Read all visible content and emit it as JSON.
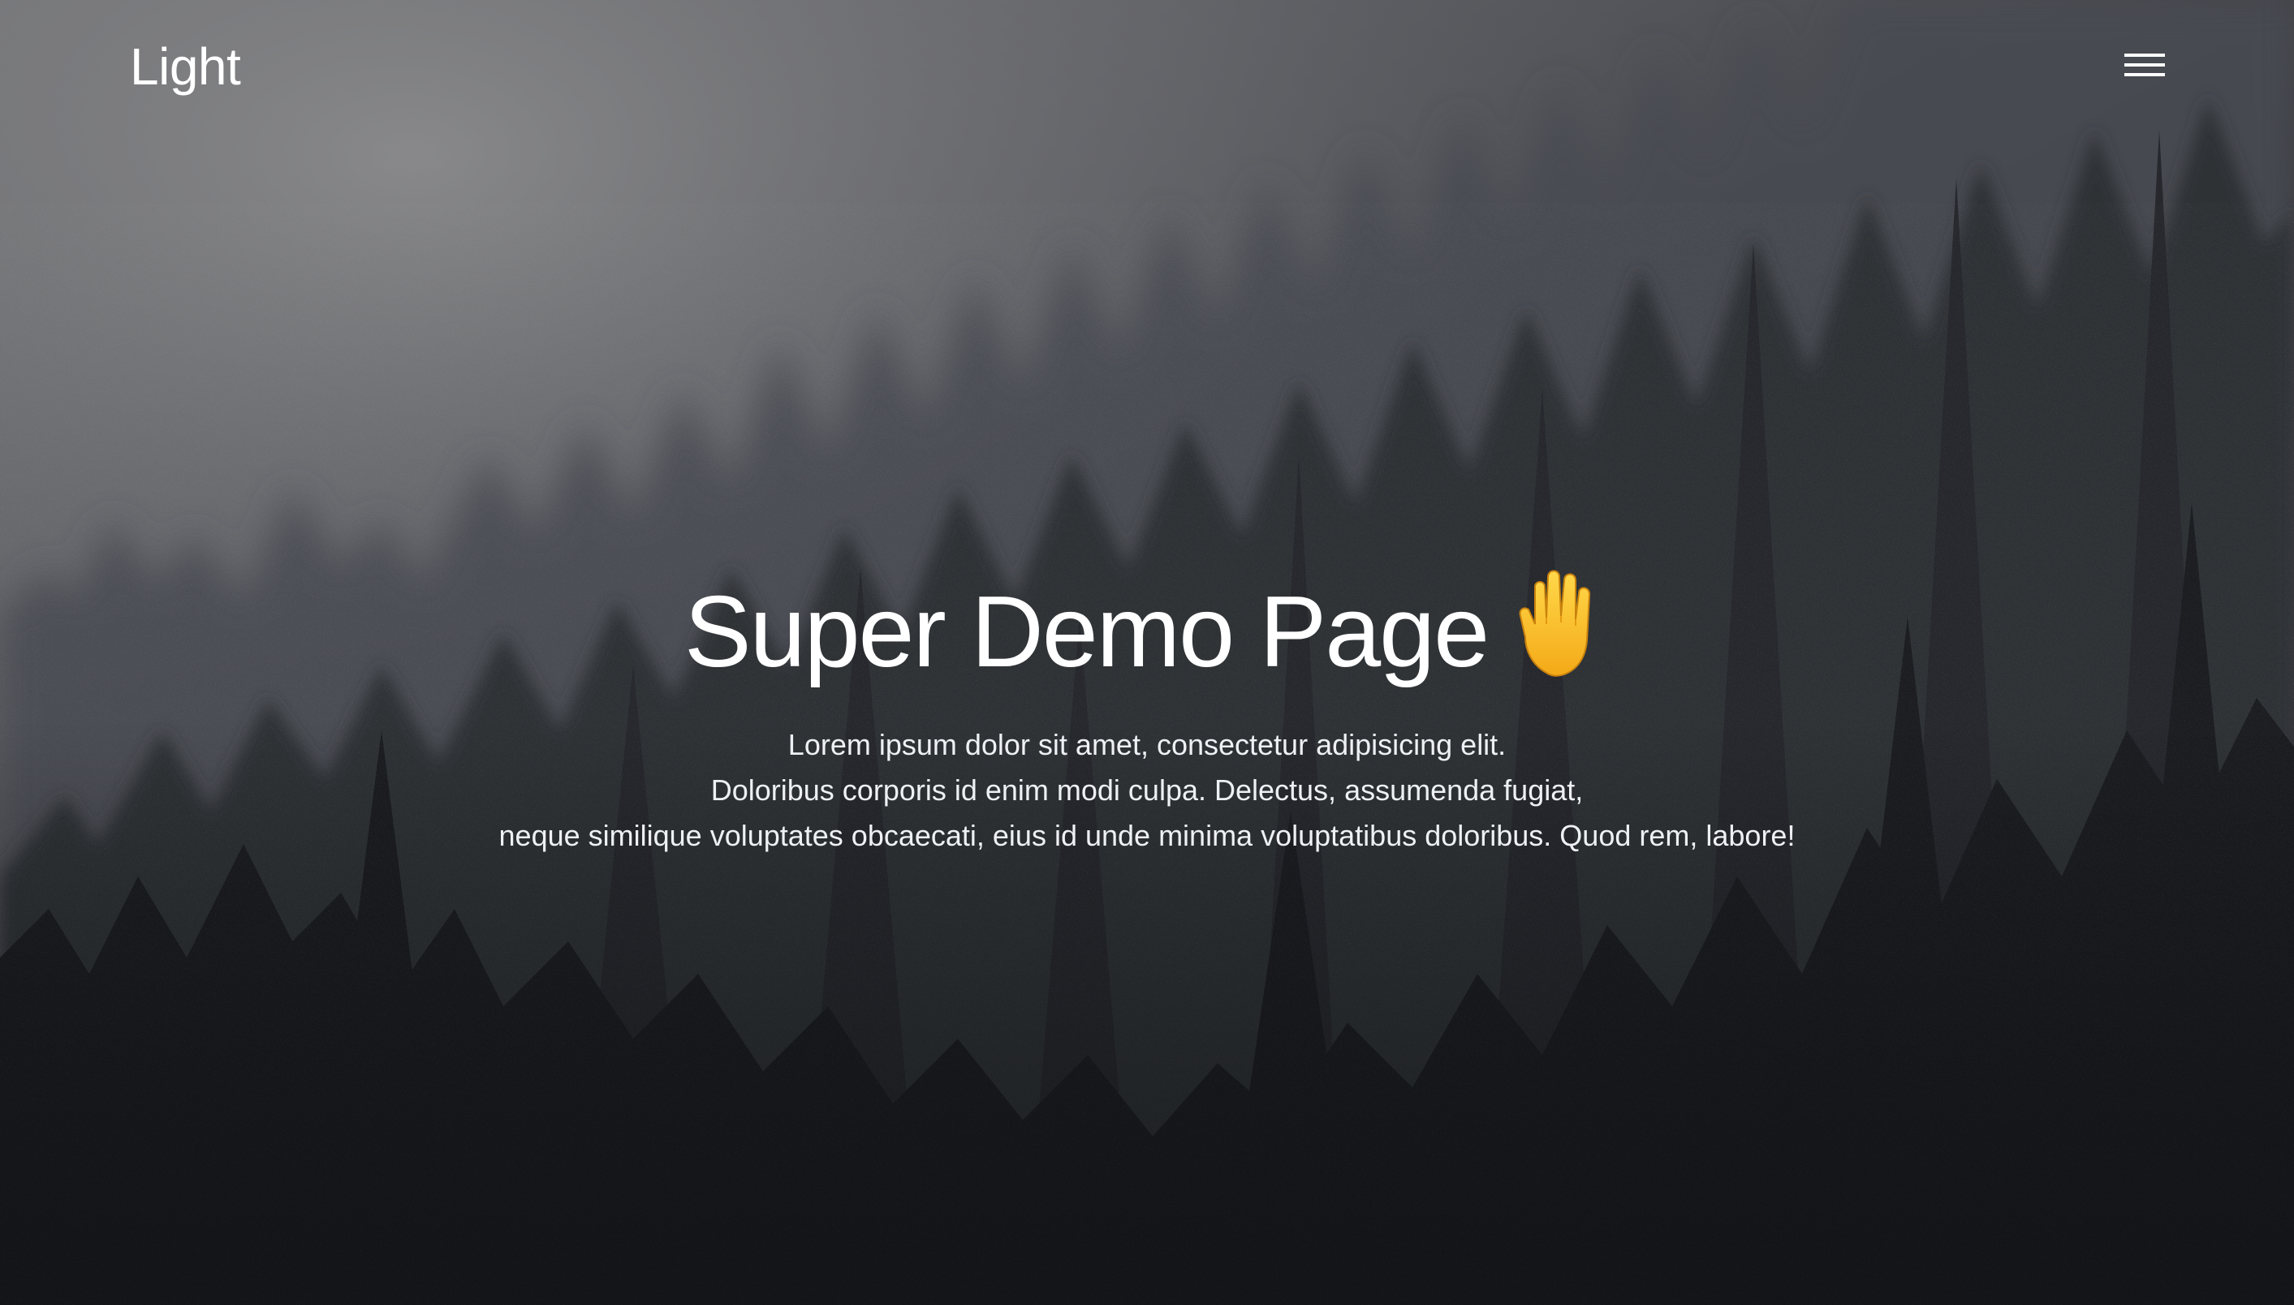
{
  "header": {
    "brand": "Light",
    "menu_icon": "hamburger-menu-icon"
  },
  "hero": {
    "title": "Super Demo Page",
    "emoji": "raised-hand",
    "lines": [
      "Lorem ipsum dolor sit amet, consectetur adipisicing elit.",
      "Doloribus corporis id enim modi culpa. Delectus, assumenda fugiat,",
      "neque similique voluptates obcaecati, eius id unde minima voluptatibus doloribus. Quod rem, labore!"
    ]
  },
  "background": {
    "scene": "foggy-pine-forest",
    "fog_color": "#8a8a8c",
    "dark_color": "#17191d"
  }
}
